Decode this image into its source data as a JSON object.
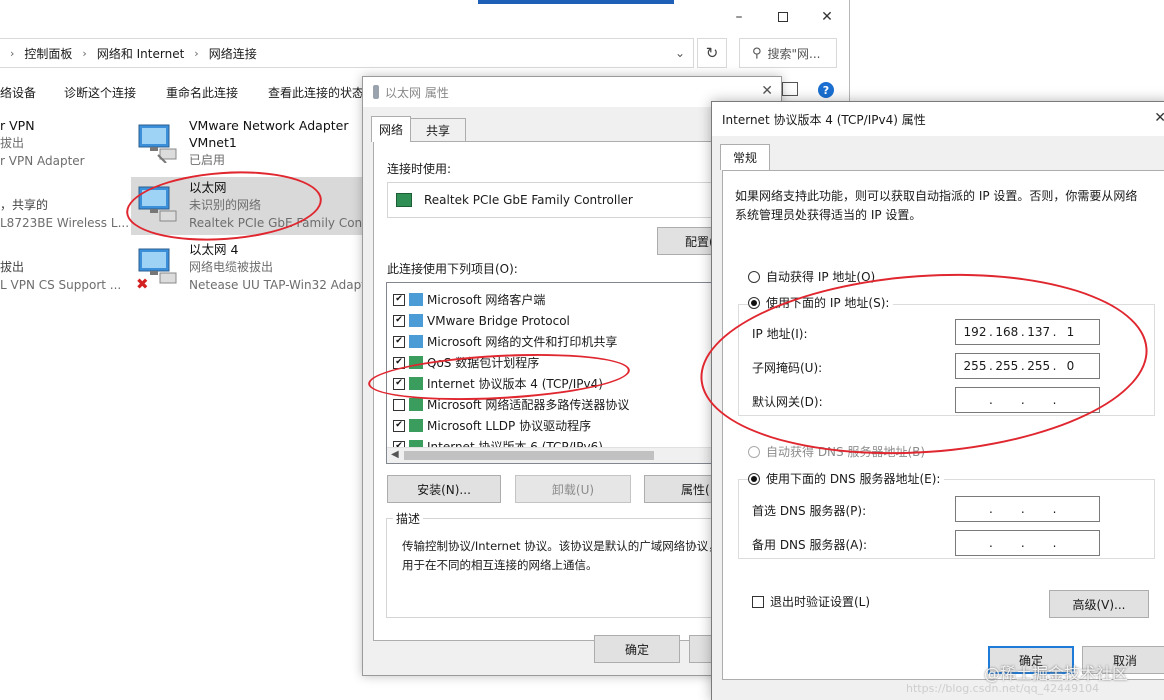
{
  "explorer": {
    "breadcrumb": [
      "控制面板",
      "网络和 Internet",
      "网络连接"
    ],
    "search_placeholder": "搜索\"网...",
    "commands": [
      "络设备",
      "诊断这个连接",
      "重命名此连接",
      "查看此连接的状态"
    ],
    "adapters": [
      {
        "name": "VMware Network Adapter",
        "line2": "VMnet1",
        "line3": "已启用"
      },
      {
        "name": "以太网",
        "line2": "未识别的网络",
        "line3": "Realtek PCIe GbE Family Contr"
      },
      {
        "name": "以太网 4",
        "line2": "网络电缆被拔出",
        "line3": "Netease UU TAP-Win32 Adapt"
      }
    ],
    "left_partial": [
      {
        "line1": "r VPN",
        "line2": "拔出",
        "line3": "r VPN Adapter"
      },
      {
        "line1": "，共享的",
        "line2": "L8723BE Wireless L..."
      },
      {
        "line1": "拔出",
        "line2": "L VPN CS Support ..."
      }
    ]
  },
  "eth_dialog": {
    "title": "以太网 属性",
    "tabs": [
      "网络",
      "共享"
    ],
    "connect_using_label": "连接时使用:",
    "adapter_name": "Realtek PCIe GbE Family Controller",
    "configure_button": "配置(",
    "items_label": "此连接使用下列项目(O):",
    "items": [
      {
        "label": "Microsoft 网络客户端",
        "checked": true
      },
      {
        "label": "VMware Bridge Protocol",
        "checked": true
      },
      {
        "label": "Microsoft 网络的文件和打印机共享",
        "checked": true
      },
      {
        "label": "QoS 数据包计划程序",
        "checked": true
      },
      {
        "label": "Internet 协议版本 4 (TCP/IPv4)",
        "checked": true
      },
      {
        "label": "Microsoft 网络适配器多路传送器协议",
        "checked": false
      },
      {
        "label": "Microsoft LLDP 协议驱动程序",
        "checked": true
      },
      {
        "label": "Internet 协议版本 6 (TCP/IPv6)",
        "checked": true
      }
    ],
    "install_button": "安装(N)...",
    "uninstall_button": "卸载(U)",
    "properties_button": "属性(",
    "description_legend": "描述",
    "description_text": "传输控制协议/Internet 协议。该协议是默认的广域网络协议，用于在不同的相互连接的网络上通信。",
    "ok_button": "确定"
  },
  "ip_dialog": {
    "title": "Internet 协议版本 4 (TCP/IPv4) 属性",
    "tab": "常规",
    "intro": "如果网络支持此功能，则可以获取自动指派的 IP 设置。否则，你需要从网络系统管理员处获得适当的 IP 设置。",
    "auto_ip": "自动获得 IP 地址(O)",
    "manual_ip": "使用下面的 IP 地址(S):",
    "ip_label": "IP 地址(I):",
    "ip_value": [
      "192",
      "168",
      "137",
      "1"
    ],
    "mask_label": "子网掩码(U):",
    "mask_value": [
      "255",
      "255",
      "255",
      "0"
    ],
    "gateway_label": "默认网关(D):",
    "auto_dns": "自动获得 DNS 服务器地址(B)",
    "manual_dns": "使用下面的 DNS 服务器地址(E):",
    "dns1_label": "首选 DNS 服务器(P):",
    "dns2_label": "备用 DNS 服务器(A):",
    "validate_label": "退出时验证设置(L)",
    "advanced_button": "高级(V)...",
    "ok_button": "确定",
    "cancel_button": "取消"
  },
  "watermark": "@稀土掘金技术社区",
  "watermark_url": "https://blog.csdn.net/qq_42449104"
}
